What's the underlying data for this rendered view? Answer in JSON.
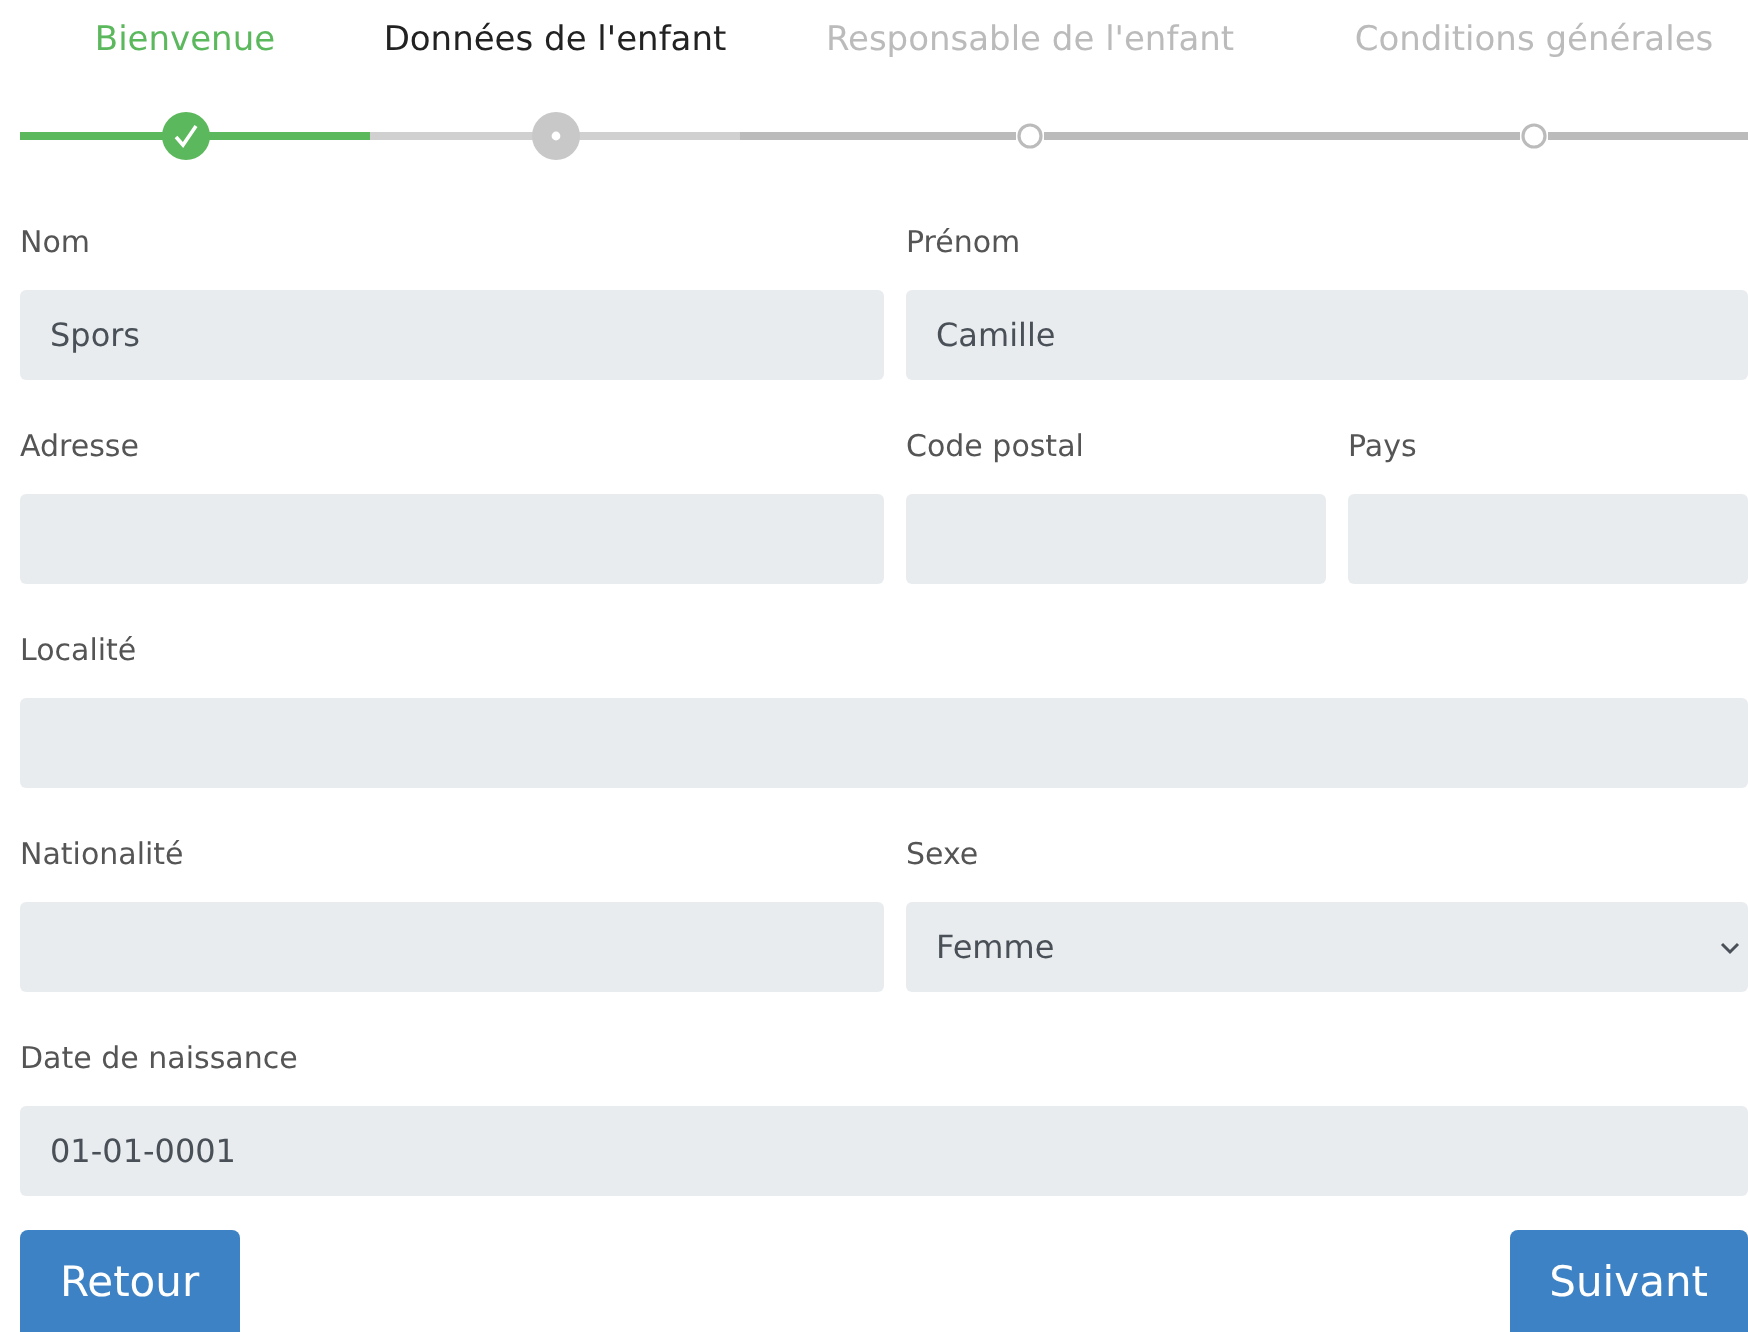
{
  "steps": [
    {
      "label": "Bienvenue",
      "done": true,
      "selected": false
    },
    {
      "label": "Données de l'enfant",
      "done": false,
      "selected": true
    },
    {
      "label": "Responsable de l'enfant",
      "done": false,
      "selected": false
    },
    {
      "label": "Conditions générales",
      "done": false,
      "selected": false
    }
  ],
  "rows": [
    [
      {
        "label": "Nom",
        "kind": "text",
        "value": "Spors"
      },
      {
        "label": "Prénom",
        "kind": "text",
        "value": "Camille"
      }
    ],
    [
      {
        "label": "Adresse",
        "kind": "text"
      },
      {
        "label": "Code postal",
        "kind": "text"
      },
      {
        "label": "Pays",
        "kind": "text"
      }
    ],
    [
      {
        "label": "Localité",
        "kind": "text"
      }
    ],
    [
      {
        "label": "Nationalité",
        "kind": "text"
      },
      {
        "label": "Sexe",
        "kind": "select",
        "value": "Femme"
      }
    ],
    [
      {
        "label": "Date de naissance",
        "kind": "text",
        "value": "01-01-0001"
      }
    ]
  ],
  "buttons": {
    "back": "Retour",
    "next": "Suivant"
  }
}
